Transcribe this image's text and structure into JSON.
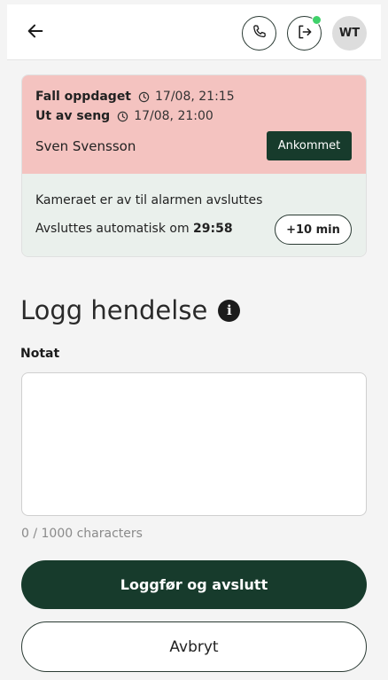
{
  "header": {
    "back_icon": "arrow-left-icon",
    "phone_icon": "phone-icon",
    "exit_icon": "exit-icon",
    "avatar_initials": "WT",
    "status_color": "#3fd16a"
  },
  "alarm": {
    "events": [
      {
        "label": "Fall oppdaget",
        "time": "17/08, 21:15"
      },
      {
        "label": "Ut av seng",
        "time": "17/08, 21:00"
      }
    ],
    "resident": "Sven Svensson",
    "arrived_button": "Ankommet",
    "camera_text": "Kameraet er av til alarmen avsluttes",
    "auto_close_prefix": "Avsluttes automatisk om",
    "auto_close_countdown": "29:58",
    "extend_button": "+10 min",
    "top_color": "#f4c3c0",
    "bottom_color": "#eaf0ec"
  },
  "log": {
    "title": "Logg hendelse",
    "info_icon_glyph": "i",
    "note_label": "Notat",
    "note_value": "",
    "char_count": "0 / 1000 characters",
    "submit_button": "Loggfør og avslutt",
    "cancel_button": "Avbryt"
  },
  "colors": {
    "accent": "#173b2c"
  }
}
